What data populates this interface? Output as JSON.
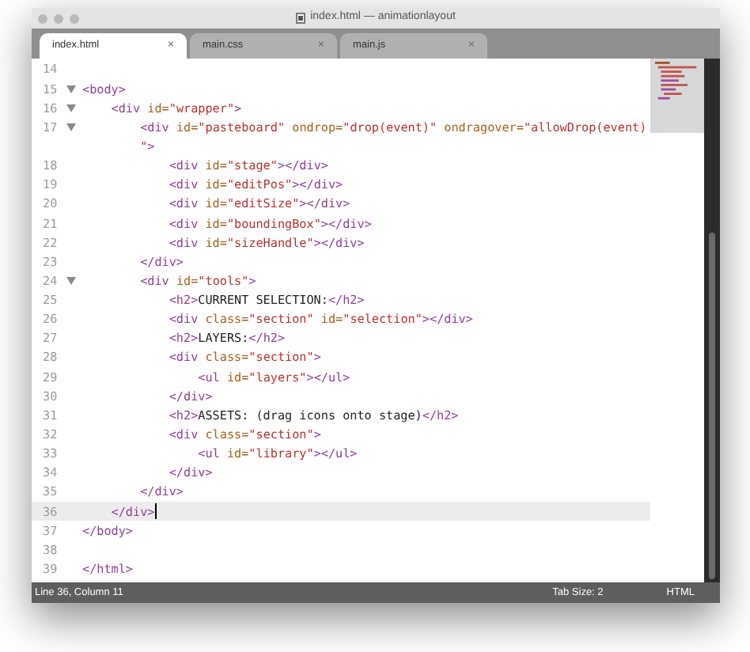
{
  "window": {
    "title": "index.html — animationlayout"
  },
  "tabs": [
    {
      "label": "index.html",
      "close": "×",
      "selected": true
    },
    {
      "label": "main.css",
      "close": "×",
      "selected": false
    },
    {
      "label": "main.js",
      "close": "×",
      "selected": false
    }
  ],
  "lines": [
    {
      "number": "14",
      "fold": false,
      "current": false
    },
    {
      "number": "15",
      "fold": true,
      "current": false,
      "tokens": [
        {
          "t": "<body>",
          "kind": "tag"
        }
      ]
    },
    {
      "number": "16",
      "fold": true,
      "current": false,
      "tokens": [
        {
          "t": "    <div",
          "kind": "tag"
        },
        {
          "t": " id=",
          "kind": "attr"
        },
        {
          "t": "\"wrapper\"",
          "kind": "string"
        },
        {
          "t": ">",
          "kind": "tag"
        }
      ]
    },
    {
      "number": "17",
      "fold": true,
      "current": false,
      "tokens": [
        {
          "t": "        <div",
          "kind": "tag"
        },
        {
          "t": " id=",
          "kind": "attr"
        },
        {
          "t": "\"pasteboard\"",
          "kind": "string"
        },
        {
          "t": " ondrop=",
          "kind": "attr"
        },
        {
          "t": "\"drop(event)\"",
          "kind": "string"
        },
        {
          "t": " ondragover=",
          "kind": "attr"
        },
        {
          "t": "\"allowDrop(event)",
          "kind": "string"
        }
      ]
    },
    {
      "fold": false,
      "current": false,
      "tokens": [
        {
          "t": "        \"",
          "kind": "string"
        },
        {
          "t": ">",
          "kind": "tag"
        }
      ]
    },
    {
      "number": "18",
      "fold": false,
      "current": false,
      "tokens": [
        {
          "t": "            <div",
          "kind": "tag"
        },
        {
          "t": " id=",
          "kind": "attr"
        },
        {
          "t": "\"stage\"",
          "kind": "string"
        },
        {
          "t": "></div>",
          "kind": "tag"
        }
      ]
    },
    {
      "number": "19",
      "fold": false,
      "current": false,
      "tokens": [
        {
          "t": "            <div",
          "kind": "tag"
        },
        {
          "t": " id=",
          "kind": "attr"
        },
        {
          "t": "\"editPos\"",
          "kind": "string"
        },
        {
          "t": "></div>",
          "kind": "tag"
        }
      ]
    },
    {
      "number": "20",
      "fold": false,
      "current": false,
      "tokens": [
        {
          "t": "            <div",
          "kind": "tag"
        },
        {
          "t": " id=",
          "kind": "attr"
        },
        {
          "t": "\"editSize\"",
          "kind": "string"
        },
        {
          "t": "></div>",
          "kind": "tag"
        }
      ]
    },
    {
      "number": "21",
      "fold": false,
      "current": false,
      "tokens": [
        {
          "t": "            <div",
          "kind": "tag"
        },
        {
          "t": " id=",
          "kind": "attr"
        },
        {
          "t": "\"boundingBox\"",
          "kind": "string"
        },
        {
          "t": "></div>",
          "kind": "tag"
        }
      ]
    },
    {
      "number": "22",
      "fold": false,
      "current": false,
      "tokens": [
        {
          "t": "            <div",
          "kind": "tag"
        },
        {
          "t": " id=",
          "kind": "attr"
        },
        {
          "t": "\"sizeHandle\"",
          "kind": "string"
        },
        {
          "t": "></div>",
          "kind": "tag"
        }
      ]
    },
    {
      "number": "23",
      "fold": false,
      "current": false,
      "tokens": [
        {
          "t": "        </div>",
          "kind": "tag"
        }
      ]
    },
    {
      "number": "24",
      "fold": true,
      "current": false,
      "tokens": [
        {
          "t": "        <div",
          "kind": "tag"
        },
        {
          "t": " id=",
          "kind": "attr"
        },
        {
          "t": "\"tools\"",
          "kind": "string"
        },
        {
          "t": ">",
          "kind": "tag"
        }
      ]
    },
    {
      "number": "25",
      "fold": false,
      "current": false,
      "tokens": [
        {
          "t": "            <h2>",
          "kind": "tag"
        },
        {
          "t": "CURRENT SELECTION:",
          "kind": "text"
        },
        {
          "t": "</h2>",
          "kind": "tag"
        }
      ]
    },
    {
      "number": "26",
      "fold": false,
      "current": false,
      "tokens": [
        {
          "t": "            <div",
          "kind": "tag"
        },
        {
          "t": " class=",
          "kind": "attr"
        },
        {
          "t": "\"section\"",
          "kind": "string"
        },
        {
          "t": " id=",
          "kind": "attr"
        },
        {
          "t": "\"selection\"",
          "kind": "string"
        },
        {
          "t": "></div>",
          "kind": "tag"
        }
      ]
    },
    {
      "number": "27",
      "fold": false,
      "current": false,
      "tokens": [
        {
          "t": "            <h2>",
          "kind": "tag"
        },
        {
          "t": "LAYERS:",
          "kind": "text"
        },
        {
          "t": "</h2>",
          "kind": "tag"
        }
      ]
    },
    {
      "number": "28",
      "fold": false,
      "current": false,
      "tokens": [
        {
          "t": "            <div",
          "kind": "tag"
        },
        {
          "t": " class=",
          "kind": "attr"
        },
        {
          "t": "\"section\"",
          "kind": "string"
        },
        {
          "t": ">",
          "kind": "tag"
        }
      ]
    },
    {
      "number": "29",
      "fold": false,
      "current": false,
      "tokens": [
        {
          "t": "                <ul",
          "kind": "tag"
        },
        {
          "t": " id=",
          "kind": "attr"
        },
        {
          "t": "\"layers\"",
          "kind": "string"
        },
        {
          "t": "></ul>",
          "kind": "tag"
        }
      ]
    },
    {
      "number": "30",
      "fold": false,
      "current": false,
      "tokens": [
        {
          "t": "            </div>",
          "kind": "tag"
        }
      ]
    },
    {
      "number": "31",
      "fold": false,
      "current": false,
      "tokens": [
        {
          "t": "            <h2>",
          "kind": "tag"
        },
        {
          "t": "ASSETS: (drag icons onto stage)",
          "kind": "text"
        },
        {
          "t": "</h2>",
          "kind": "tag"
        }
      ]
    },
    {
      "number": "32",
      "fold": false,
      "current": false,
      "tokens": [
        {
          "t": "            <div",
          "kind": "tag"
        },
        {
          "t": " class=",
          "kind": "attr"
        },
        {
          "t": "\"section\"",
          "kind": "string"
        },
        {
          "t": ">",
          "kind": "tag"
        }
      ]
    },
    {
      "number": "33",
      "fold": false,
      "current": false,
      "tokens": [
        {
          "t": "                <ul",
          "kind": "tag"
        },
        {
          "t": " id=",
          "kind": "attr"
        },
        {
          "t": "\"library\"",
          "kind": "string"
        },
        {
          "t": "></ul>",
          "kind": "tag"
        }
      ]
    },
    {
      "number": "34",
      "fold": false,
      "current": false,
      "tokens": [
        {
          "t": "            </div>",
          "kind": "tag"
        }
      ]
    },
    {
      "number": "35",
      "fold": false,
      "current": false,
      "tokens": [
        {
          "t": "        </div>",
          "kind": "tag"
        }
      ]
    },
    {
      "number": "36",
      "fold": false,
      "current": true,
      "tokens": [
        {
          "t": "    </div>",
          "kind": "tag"
        }
      ]
    },
    {
      "number": "37",
      "fold": false,
      "current": false,
      "tokens": [
        {
          "t": "</body>",
          "kind": "tag"
        }
      ]
    },
    {
      "number": "38",
      "fold": false,
      "current": false
    },
    {
      "number": "39",
      "fold": false,
      "current": false,
      "tokens": [
        {
          "t": "</html>",
          "kind": "tag"
        }
      ]
    }
  ],
  "status_bar": {
    "position": "Line 36, Column 11",
    "tab_size": "Tab Size: 2",
    "syntax": "HTML"
  }
}
